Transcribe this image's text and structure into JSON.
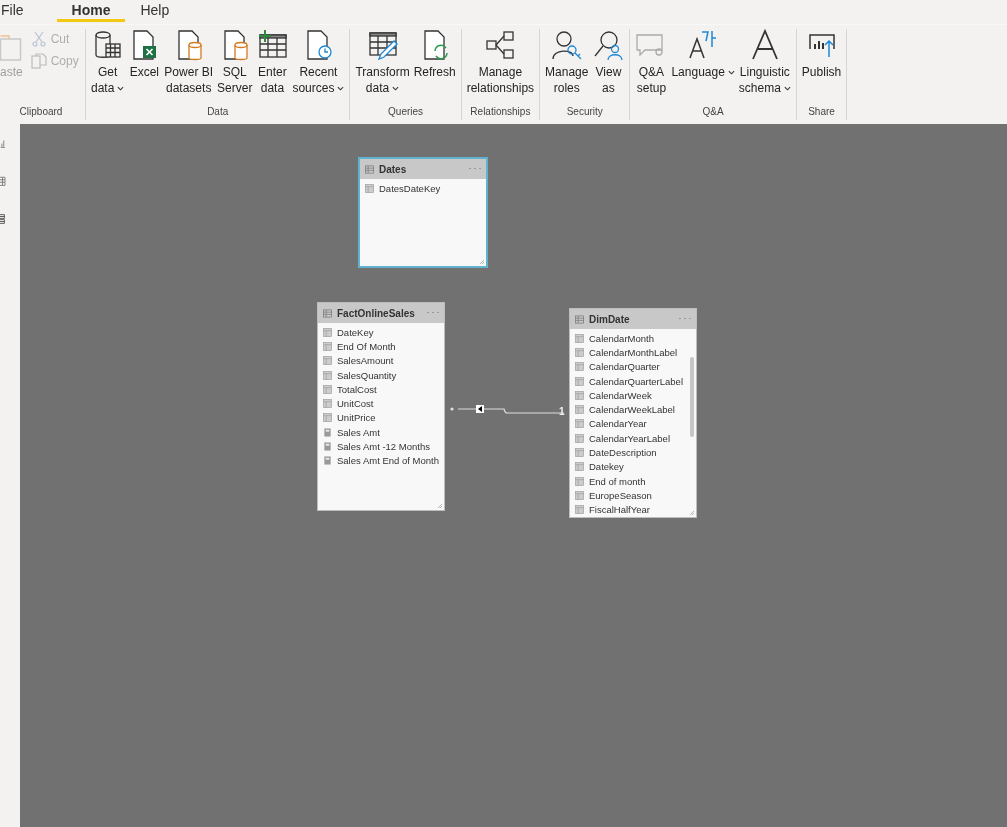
{
  "menu_tabs": [
    {
      "label": "File",
      "selected": false
    },
    {
      "label": "Home",
      "selected": true
    },
    {
      "label": "Help",
      "selected": false
    }
  ],
  "ribbon_groups": [
    {
      "label": "Clipboard",
      "buttons": [
        {
          "kind": "paste",
          "lines": [
            "aste"
          ],
          "dropdown": false,
          "disabled": true
        }
      ],
      "small_buttons": [
        {
          "kind": "cut",
          "label": "Cut",
          "disabled": true
        },
        {
          "kind": "copy",
          "label": "Copy",
          "disabled": true
        }
      ]
    },
    {
      "label": "Data",
      "buttons": [
        {
          "kind": "get-data",
          "lines": [
            "Get",
            "data"
          ],
          "dropdown": true,
          "disabled": false
        },
        {
          "kind": "excel",
          "lines": [
            "Excel"
          ],
          "dropdown": false,
          "disabled": false
        },
        {
          "kind": "datasets",
          "lines": [
            "Power BI",
            "datasets"
          ],
          "dropdown": false,
          "disabled": false
        },
        {
          "kind": "sql",
          "lines": [
            "SQL",
            "Server"
          ],
          "dropdown": false,
          "disabled": false
        },
        {
          "kind": "enter-data",
          "lines": [
            "Enter",
            "data"
          ],
          "dropdown": false,
          "disabled": false
        },
        {
          "kind": "recent",
          "lines": [
            "Recent",
            "sources"
          ],
          "dropdown": true,
          "disabled": false
        }
      ]
    },
    {
      "label": "Queries",
      "buttons": [
        {
          "kind": "transform",
          "lines": [
            "Transform",
            "data"
          ],
          "dropdown": true,
          "disabled": false
        },
        {
          "kind": "refresh",
          "lines": [
            "Refresh"
          ],
          "dropdown": false,
          "disabled": false
        }
      ]
    },
    {
      "label": "Relationships",
      "buttons": [
        {
          "kind": "relationships",
          "lines": [
            "Manage",
            "relationships"
          ],
          "dropdown": false,
          "disabled": false
        }
      ]
    },
    {
      "label": "Security",
      "buttons": [
        {
          "kind": "roles",
          "lines": [
            "Manage",
            "roles"
          ],
          "dropdown": false,
          "disabled": false
        },
        {
          "kind": "view-as",
          "lines": [
            "View",
            "as"
          ],
          "dropdown": false,
          "disabled": false
        }
      ]
    },
    {
      "label": "Q&A",
      "buttons": [
        {
          "kind": "qa",
          "lines": [
            "Q&A",
            "setup"
          ],
          "dropdown": false,
          "disabled": false
        },
        {
          "kind": "language",
          "lines": [
            "Language"
          ],
          "dropdown": true,
          "disabled": false
        },
        {
          "kind": "linguistic",
          "lines": [
            "Linguistic",
            "schema"
          ],
          "dropdown": true,
          "disabled": false
        }
      ]
    },
    {
      "label": "Share",
      "buttons": [
        {
          "kind": "publish",
          "lines": [
            "Publish"
          ],
          "dropdown": false,
          "disabled": false
        }
      ]
    }
  ],
  "tables": [
    {
      "name": "Dates",
      "selected": true,
      "fields": [
        {
          "name": "DatesDateKey",
          "kind": "column"
        }
      ]
    },
    {
      "name": "FactOnlineSales",
      "selected": false,
      "fields": [
        {
          "name": "DateKey",
          "kind": "column"
        },
        {
          "name": "End Of Month",
          "kind": "column"
        },
        {
          "name": "SalesAmount",
          "kind": "column"
        },
        {
          "name": "SalesQuantity",
          "kind": "column"
        },
        {
          "name": "TotalCost",
          "kind": "column"
        },
        {
          "name": "UnitCost",
          "kind": "column"
        },
        {
          "name": "UnitPrice",
          "kind": "column"
        },
        {
          "name": "Sales Amt",
          "kind": "measure"
        },
        {
          "name": "Sales Amt -12 Months",
          "kind": "measure"
        },
        {
          "name": "Sales Amt End of Month",
          "kind": "measure"
        }
      ]
    },
    {
      "name": "DimDate",
      "selected": false,
      "fields": [
        {
          "name": "CalendarMonth",
          "kind": "column"
        },
        {
          "name": "CalendarMonthLabel",
          "kind": "column"
        },
        {
          "name": "CalendarQuarter",
          "kind": "column"
        },
        {
          "name": "CalendarQuarterLabel",
          "kind": "column"
        },
        {
          "name": "CalendarWeek",
          "kind": "column"
        },
        {
          "name": "CalendarWeekLabel",
          "kind": "column"
        },
        {
          "name": "CalendarYear",
          "kind": "column"
        },
        {
          "name": "CalendarYearLabel",
          "kind": "column"
        },
        {
          "name": "DateDescription",
          "kind": "column"
        },
        {
          "name": "Datekey",
          "kind": "column"
        },
        {
          "name": "End of month",
          "kind": "column"
        },
        {
          "name": "EuropeSeason",
          "kind": "column"
        },
        {
          "name": "FiscalHalfYear",
          "kind": "column"
        }
      ]
    }
  ],
  "relationship": {
    "one_side_label": "1"
  }
}
